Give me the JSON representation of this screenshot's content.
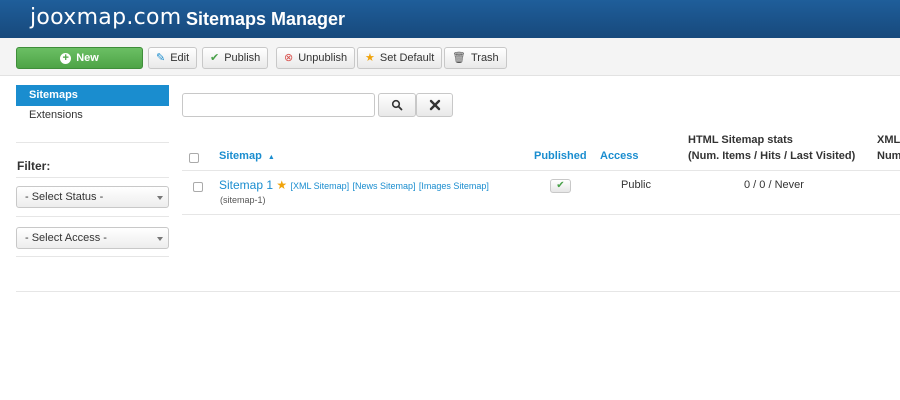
{
  "header": {
    "logo": "jooxmap.com",
    "title": "Sitemaps Manager"
  },
  "toolbar": {
    "new_label": "New",
    "edit_label": "Edit",
    "publish_label": "Publish",
    "unpublish_label": "Unpublish",
    "set_default_label": "Set Default",
    "trash_label": "Trash"
  },
  "sidebar": {
    "items": [
      {
        "label": "Sitemaps",
        "active": true
      },
      {
        "label": "Extensions",
        "active": false
      }
    ],
    "filter_label": "Filter:",
    "status_select": "- Select Status -",
    "access_select": "- Select Access -"
  },
  "search": {
    "value": "",
    "placeholder": ""
  },
  "table": {
    "columns": {
      "sitemap": "Sitemap",
      "sort_arrow": "▲",
      "published": "Published",
      "access": "Access",
      "html_stats_line1": "HTML Sitemap stats",
      "html_stats_line2": "(Num. Items / Hits / Last Visited)",
      "xml_stats_line1": "XML",
      "xml_stats_line2": "Num"
    },
    "rows": [
      {
        "name": "Sitemap 1",
        "xml_link": "[XML Sitemap]",
        "news_link": "[News Sitemap]",
        "images_link": "[Images Sitemap]",
        "alias": "(sitemap-1)",
        "access": "Public",
        "html_stats": "0 / 0 / Never"
      }
    ]
  },
  "colors": {
    "header_bg": "#1f5e9a",
    "accent": "#1a8dcf",
    "new_button": "#5cb85c",
    "star": "#f0a30a",
    "unpublish_icon": "#d9534f"
  }
}
